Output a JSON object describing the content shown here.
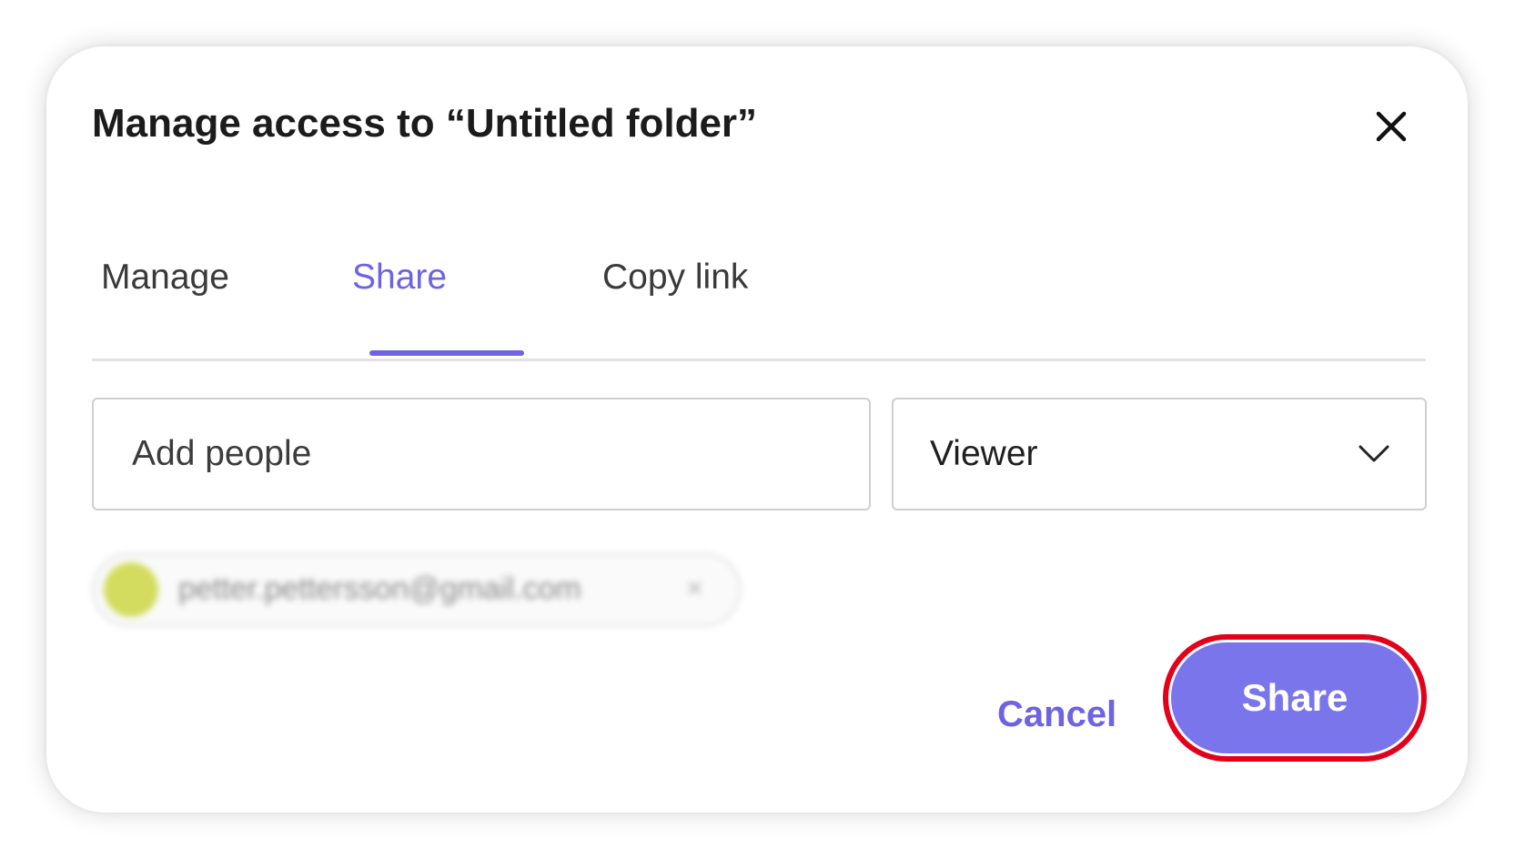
{
  "dialog": {
    "title": "Manage access to “Untitled folder”",
    "close_icon": "close-icon"
  },
  "tabs": [
    {
      "label": "Manage",
      "active": false
    },
    {
      "label": "Share",
      "active": true
    },
    {
      "label": "Copy link",
      "active": false
    }
  ],
  "add_people": {
    "placeholder": "Add people",
    "value": ""
  },
  "role_select": {
    "selected": "Viewer",
    "icon": "chevron-down-icon"
  },
  "chip": {
    "email": "petter.pettersson@gmail.com",
    "remove_glyph": "×",
    "blurred": true
  },
  "actions": {
    "cancel_label": "Cancel",
    "share_label": "Share"
  },
  "colors": {
    "accent": "#6d63e3",
    "share_button_bg": "#7b75ec",
    "highlight_border": "#e3001b",
    "avatar": "#d3dc5e"
  }
}
